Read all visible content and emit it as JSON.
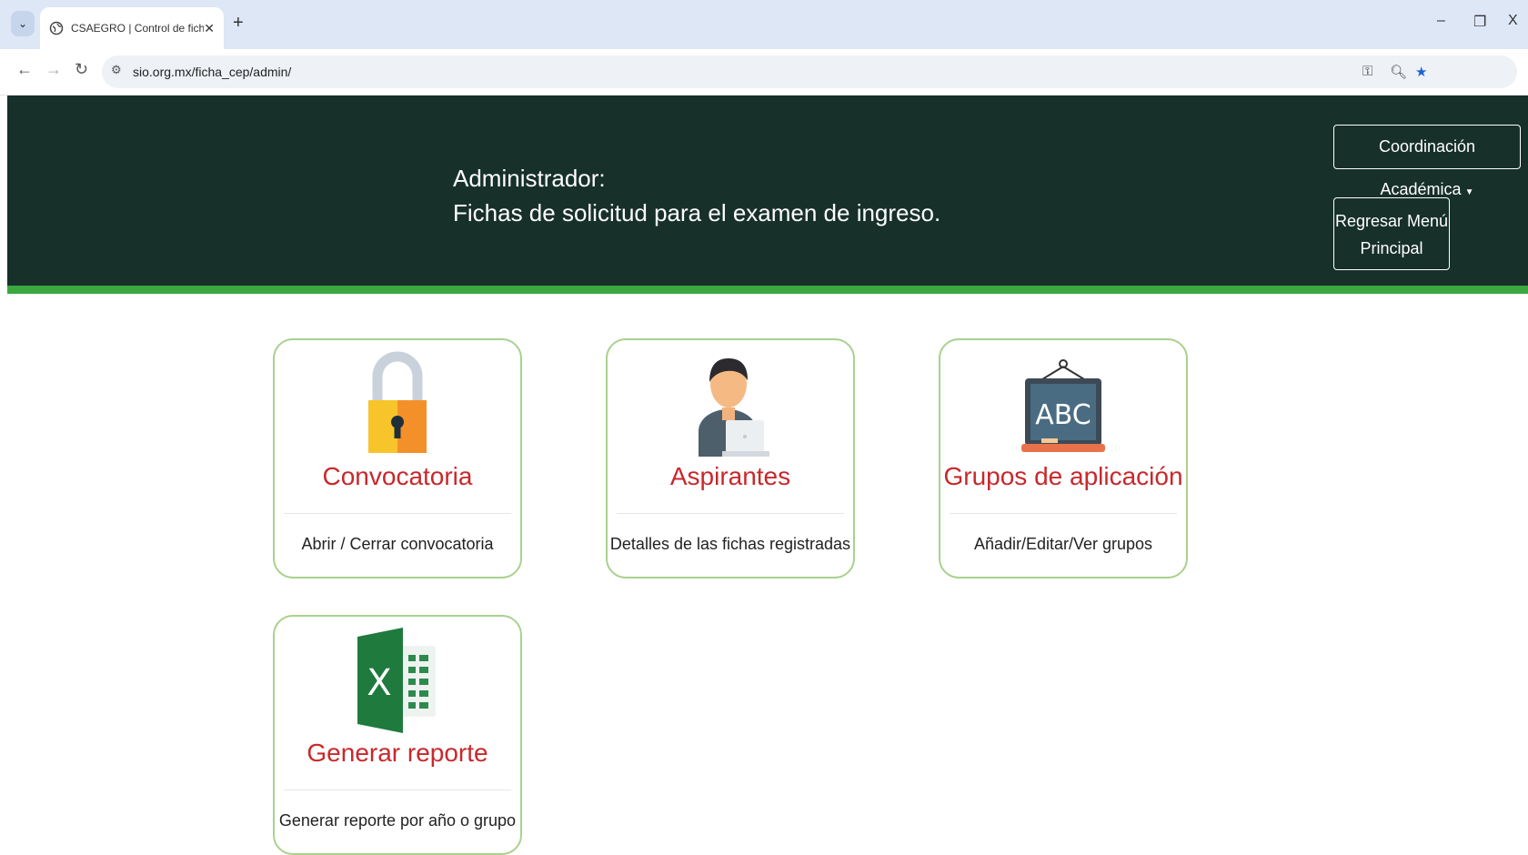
{
  "browser": {
    "tab_title": "CSAEGRO | Control de fichas CE",
    "tab_close": "✕",
    "new_tab": "+",
    "url": "sio.org.mx/ficha_cep/admin/",
    "window_controls": {
      "minimize": "–",
      "restore": "❐",
      "close": "X"
    }
  },
  "header": {
    "title_line1": "Administrador:",
    "title_line2": "Fichas de solicitud para el examen de ingreso.",
    "coord_button": "Coordinación Académica",
    "back_button_line1": "Regresar Menú",
    "back_button_line2": "Principal",
    "bg_color": "#17302a",
    "accent_color": "#3aa83e"
  },
  "cards": [
    {
      "title": "Convocatoria",
      "description": "Abrir / Cerrar convocatoria",
      "icon": "padlock-icon"
    },
    {
      "title": "Aspirantes",
      "description": "Detalles de las fichas registradas",
      "icon": "person-laptop-icon"
    },
    {
      "title": "Grupos de aplicación",
      "description": "Añadir/Editar/Ver grupos",
      "icon": "chalkboard-abc-icon",
      "board_text": "ABC"
    },
    {
      "title": "Generar reporte",
      "description": "Generar reporte por año o grupo",
      "icon": "excel-icon",
      "excel_letter": "X"
    }
  ],
  "colors": {
    "card_title": "#c8282c",
    "card_border": "#a9d18e"
  }
}
